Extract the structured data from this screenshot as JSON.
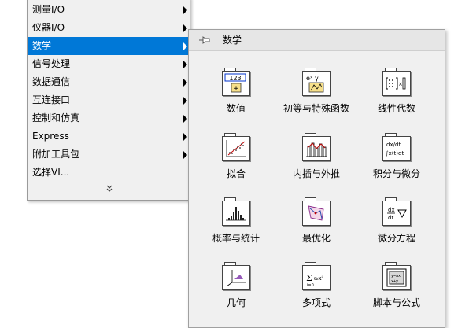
{
  "menu": {
    "items": [
      {
        "label": "测量I/O",
        "has_submenu": true
      },
      {
        "label": "仪器I/O",
        "has_submenu": true
      },
      {
        "label": "数学",
        "has_submenu": true,
        "selected": true
      },
      {
        "label": "信号处理",
        "has_submenu": true
      },
      {
        "label": "数据通信",
        "has_submenu": true
      },
      {
        "label": "互连接口",
        "has_submenu": true
      },
      {
        "label": "控制和仿真",
        "has_submenu": true
      },
      {
        "label": "Express",
        "has_submenu": true
      },
      {
        "label": "附加工具包",
        "has_submenu": true
      },
      {
        "label": "选择VI...",
        "has_submenu": false
      }
    ],
    "more_glyph": "⌄⌄"
  },
  "palette": {
    "title": "数学",
    "pin_icon": "pin-icon",
    "items": [
      {
        "label": "数值",
        "icon": "numeric-123-icon",
        "tile_text": "123"
      },
      {
        "label": "初等与特殊函数",
        "icon": "elementary-special-functions-icon",
        "tile_text": "eˣ γ"
      },
      {
        "label": "线性代数",
        "icon": "linear-algebra-matrix-icon",
        "tile_text": "[A]×"
      },
      {
        "label": "拟合",
        "icon": "curve-fitting-icon",
        "tile_text": ""
      },
      {
        "label": "内插与外推",
        "icon": "interpolation-extrapolation-icon",
        "tile_text": ""
      },
      {
        "label": "积分与微分",
        "icon": "integration-differentiation-icon",
        "tile_text": "dx/dt ∫x(t)dt"
      },
      {
        "label": "概率与统计",
        "icon": "probability-statistics-icon",
        "tile_text": ""
      },
      {
        "label": "最优化",
        "icon": "optimization-icon",
        "tile_text": ""
      },
      {
        "label": "微分方程",
        "icon": "differential-equations-icon",
        "tile_text": "dx/dt ∇"
      },
      {
        "label": "几何",
        "icon": "geometry-axes-icon",
        "tile_text": ""
      },
      {
        "label": "多项式",
        "icon": "polynomial-icon",
        "tile_text": "Σaᵢxⁱ"
      },
      {
        "label": "脚本与公式",
        "icon": "script-formula-icon",
        "tile_text": "x+y"
      }
    ]
  },
  "colors": {
    "selected_bg": "#0078d7",
    "menu_bg": "#f0f0f0",
    "palette_bg": "#f0f0f0"
  }
}
